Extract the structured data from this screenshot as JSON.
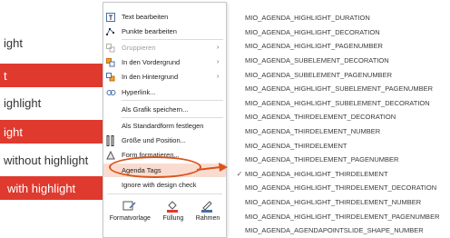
{
  "slide": {
    "rows": [
      {
        "text": "ight",
        "style": "plain"
      },
      {
        "text": "t",
        "style": "red"
      },
      {
        "text": "ighlight",
        "style": "plain"
      },
      {
        "text": "ight",
        "style": "red"
      },
      {
        "text": "without highlight",
        "style": "plain"
      },
      {
        "text": "with highlight",
        "style": "red"
      }
    ],
    "accent_color": "#e03a2f"
  },
  "context_menu": {
    "items": [
      {
        "label": "Text bearbeiten",
        "icon": "text-edit-icon",
        "enabled": true
      },
      {
        "label": "Punkte bearbeiten",
        "icon": "edit-points-icon",
        "enabled": true
      },
      {
        "label": "Gruppieren",
        "icon": "group-icon",
        "enabled": false,
        "submenu": true
      },
      {
        "label": "In den Vordergrund",
        "icon": "bring-front-icon",
        "enabled": true,
        "submenu": true
      },
      {
        "label": "In den Hintergrund",
        "icon": "send-back-icon",
        "enabled": true,
        "submenu": true
      },
      {
        "label": "Hyperlink...",
        "icon": "hyperlink-icon",
        "enabled": true
      },
      {
        "label": "Als Grafik speichern...",
        "icon": "",
        "enabled": true
      },
      {
        "label": "Als Standardform festlegen",
        "icon": "",
        "enabled": true
      },
      {
        "label": "Größe und Position...",
        "icon": "size-position-icon",
        "enabled": true
      },
      {
        "label": "Form formatieren...",
        "icon": "format-shape-icon",
        "enabled": true
      },
      {
        "label": "Agenda Tags",
        "icon": "",
        "enabled": true,
        "highlighted": true
      },
      {
        "label": "Ignore with design check",
        "icon": "",
        "enabled": true
      }
    ],
    "tools": [
      {
        "label": "Formatvorlage",
        "icon": "style-icon"
      },
      {
        "label": "Füllung",
        "icon": "fill-icon"
      },
      {
        "label": "Rahmen",
        "icon": "outline-icon"
      }
    ]
  },
  "tags_list": {
    "items": [
      {
        "label": "MIO_AGENDA_HIGHLIGHT_DURATION",
        "checked": false
      },
      {
        "label": "MIO_AGENDA_HIGHLIGHT_DECORATION",
        "checked": false
      },
      {
        "label": "MIO_AGENDA_HIGHLIGHT_PAGENUMBER",
        "checked": false
      },
      {
        "label": "MIO_AGENDA_SUBELEMENT_DECORATION",
        "checked": false
      },
      {
        "label": "MIO_AGENDA_SUBELEMENT_PAGENUMBER",
        "checked": false
      },
      {
        "label": "MIO_AGENDA_HIGHLIGHT_SUBELEMENT_PAGENUMBER",
        "checked": false
      },
      {
        "label": "MIO_AGENDA_HIGHLIGHT_SUBELEMENT_DECORATION",
        "checked": false
      },
      {
        "label": "MIO_AGENDA_THIRDELEMENT_DECORATION",
        "checked": false
      },
      {
        "label": "MIO_AGENDA_THIRDELEMENT_NUMBER",
        "checked": false
      },
      {
        "label": "MIO_AGENDA_THIRDELEMENT",
        "checked": false
      },
      {
        "label": "MIO_AGENDA_THIRDELEMENT_PAGENUMBER",
        "checked": false
      },
      {
        "label": "MIO_AGENDA_HIGHLIGHT_THIRDELEMENT",
        "checked": true
      },
      {
        "label": "MIO_AGENDA_HIGHLIGHT_THIRDELEMENT_DECORATION",
        "checked": false
      },
      {
        "label": "MIO_AGENDA_HIGHLIGHT_THIRDELEMENT_NUMBER",
        "checked": false
      },
      {
        "label": "MIO_AGENDA_HIGHLIGHT_THIRDELEMENT_PAGENUMBER",
        "checked": false
      },
      {
        "label": "MIO_AGENDA_AGENDAPOINTSLIDE_SHAPE_NUMBER",
        "checked": false
      }
    ]
  },
  "annotation": {
    "color": "#d9541c"
  },
  "check_mark": "✓",
  "submenu_arrow": "›"
}
